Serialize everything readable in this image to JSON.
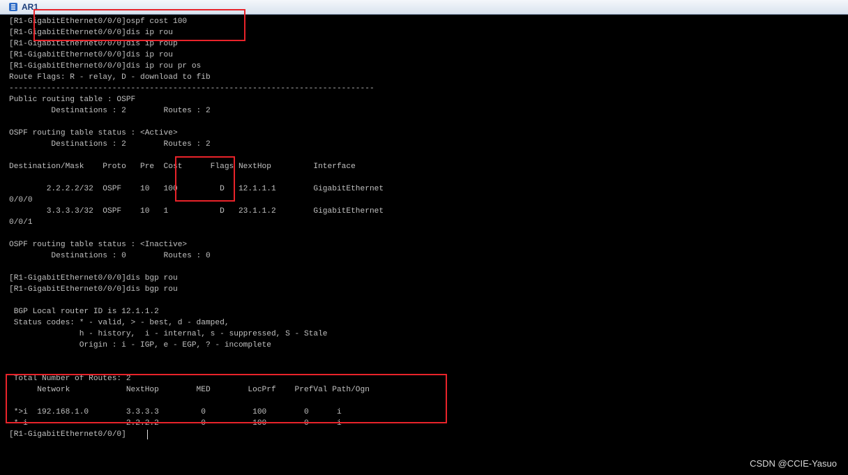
{
  "window": {
    "title": "AR1",
    "icon": "router-app-icon"
  },
  "terminal": {
    "lines": [
      "[R1-GigabitEthernet0/0/0]ospf cost 100",
      "[R1-GigabitEthernet0/0/0]dis ip rou",
      "[R1-GigabitEthernet0/0/0]dis ip roup",
      "[R1-GigabitEthernet0/0/0]dis ip rou",
      "[R1-GigabitEthernet0/0/0]dis ip rou pr os",
      "Route Flags: R - relay, D - download to fib",
      "------------------------------------------------------------------------------",
      "Public routing table : OSPF",
      "         Destinations : 2        Routes : 2",
      "",
      "OSPF routing table status : <Active>",
      "         Destinations : 2        Routes : 2",
      "",
      "Destination/Mask    Proto   Pre  Cost      Flags NextHop         Interface",
      "",
      "        2.2.2.2/32  OSPF    10   100         D   12.1.1.1        GigabitEthernet",
      "0/0/0",
      "        3.3.3.3/32  OSPF    10   1           D   23.1.1.2        GigabitEthernet",
      "0/0/1",
      "",
      "OSPF routing table status : <Inactive>",
      "         Destinations : 0        Routes : 0",
      "",
      "[R1-GigabitEthernet0/0/0]dis bgp rou",
      "[R1-GigabitEthernet0/0/0]dis bgp rou",
      "",
      " BGP Local router ID is 12.1.1.2",
      " Status codes: * - valid, > - best, d - damped,",
      "               h - history,  i - internal, s - suppressed, S - Stale",
      "               Origin : i - IGP, e - EGP, ? - incomplete",
      "",
      "",
      " Total Number of Routes: 2",
      "      Network            NextHop        MED        LocPrf    PrefVal Path/Ogn",
      "",
      " *>i  192.168.1.0        3.3.3.3         0          100        0      i",
      " * i                     2.2.2.2         0          100        0      i",
      "[R1-GigabitEthernet0/0/0]"
    ]
  },
  "watermark": "CSDN @CCIE-Yasuo",
  "colors": {
    "terminal_background": "#000000",
    "terminal_text": "#c0c0c0",
    "highlight_border": "#e8232a"
  }
}
